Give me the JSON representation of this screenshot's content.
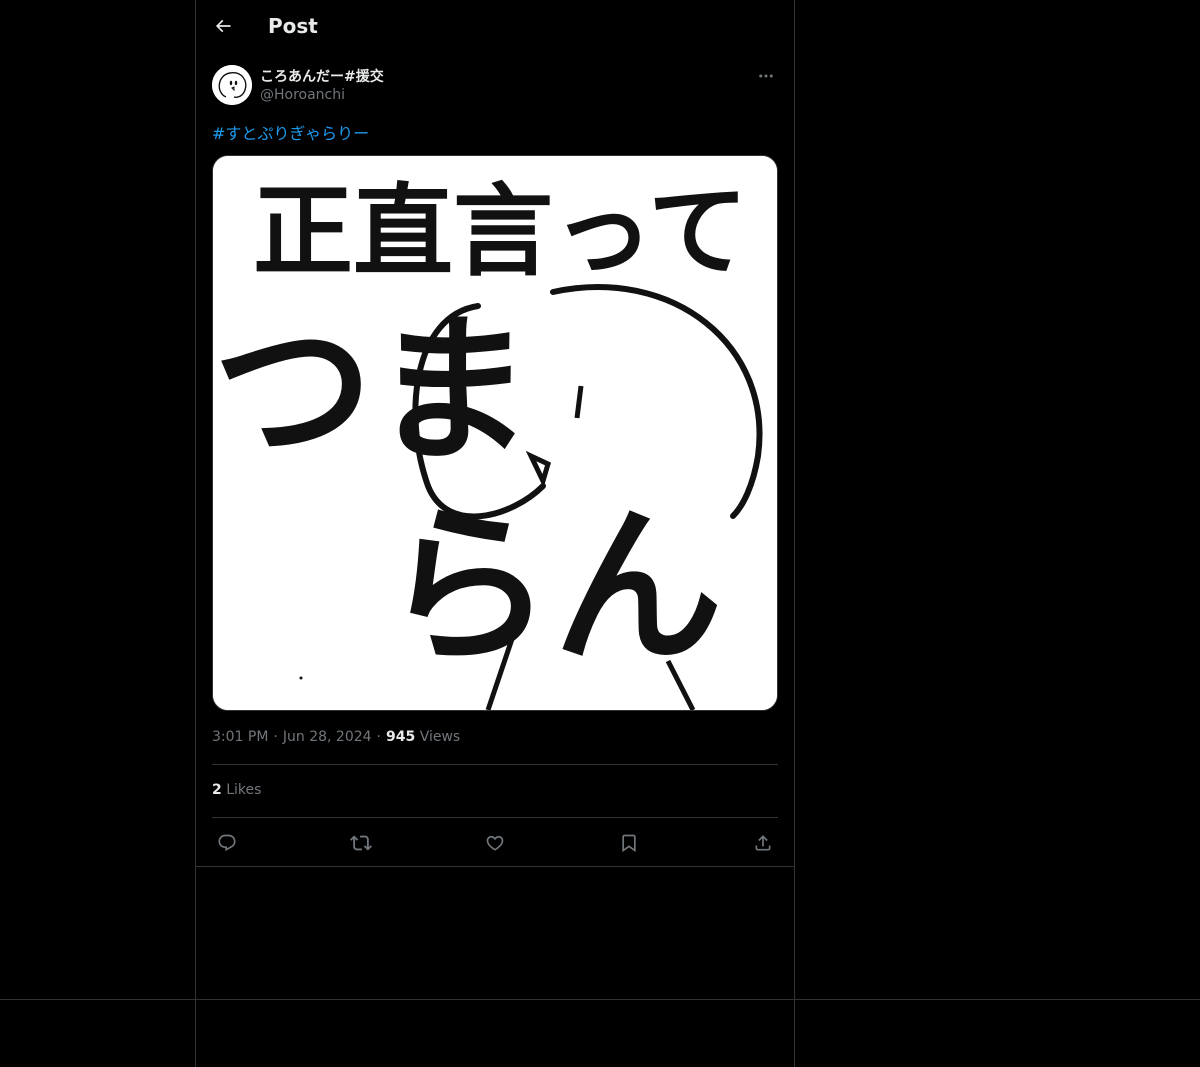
{
  "header": {
    "title": "Post",
    "back_icon": "arrow-left-icon"
  },
  "post": {
    "author": {
      "display_name": "ころあんだー#援交",
      "handle": "@Horoanchi"
    },
    "text_hashtag": "#すとぷりぎゃらりー",
    "image": {
      "line1": "正直言って",
      "line2_a": "つま",
      "line2_b": "らん"
    },
    "meta": {
      "time": "3:01 PM",
      "separator": "·",
      "date": "Jun 28, 2024",
      "views_count": "945",
      "views_label": "Views"
    },
    "likes": {
      "count": "2",
      "label": "Likes"
    },
    "actions": [
      "reply-icon",
      "retweet-icon",
      "like-icon",
      "bookmark-icon",
      "share-icon"
    ]
  },
  "colors": {
    "background": "#000000",
    "text": "#e7e9ea",
    "muted": "#71767b",
    "link": "#1d9bf0",
    "border": "#2f3336"
  }
}
